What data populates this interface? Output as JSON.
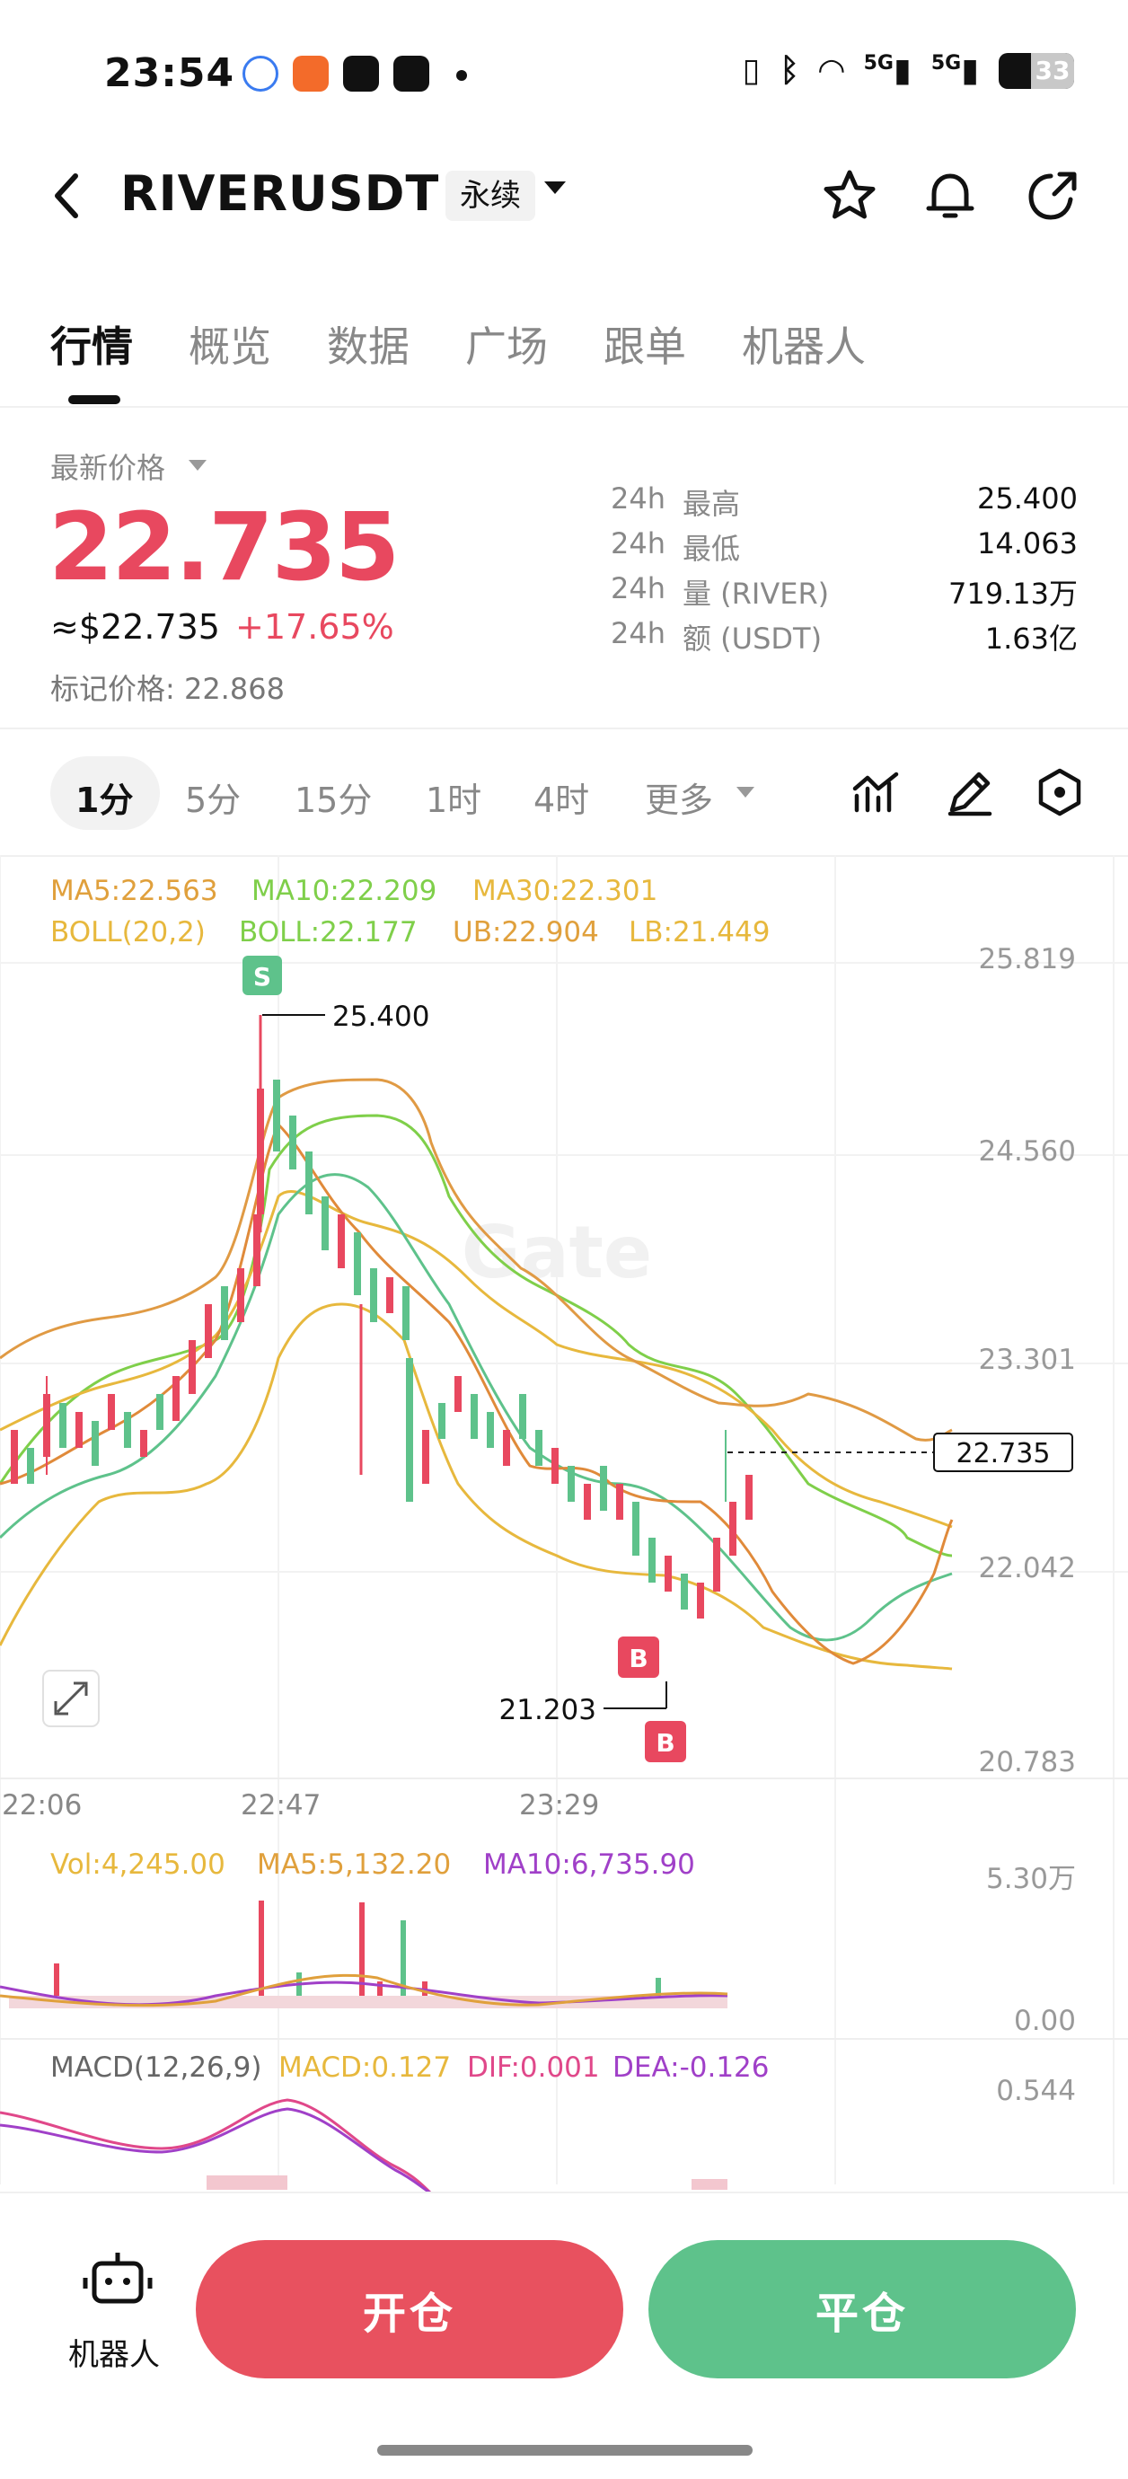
{
  "status_bar": {
    "time": "23:54",
    "network_1": "5G",
    "network_2": "5G",
    "battery": "33"
  },
  "header": {
    "symbol": "RIVERUSDT",
    "contract_type": "永续"
  },
  "tabs": [
    "行情",
    "概览",
    "数据",
    "广场",
    "跟单",
    "机器人"
  ],
  "price": {
    "label": "最新价格",
    "last": "22.735",
    "usd": "≈$22.735",
    "change": "+17.65%",
    "mark": "标记价格: 22.868"
  },
  "stats": [
    {
      "period": "24h",
      "label": "最高",
      "value": "25.400"
    },
    {
      "period": "24h",
      "label": "最低",
      "value": "14.063"
    },
    {
      "period": "24h",
      "label": "量 (RIVER)",
      "value": "719.13万"
    },
    {
      "period": "24h",
      "label": "额 (USDT)",
      "value": "1.63亿"
    }
  ],
  "intervals": [
    "1分",
    "5分",
    "15分",
    "1时",
    "4时",
    "更多"
  ],
  "indicators": {
    "ma5": "MA5:22.563",
    "ma10": "MA10:22.209",
    "ma30": "MA30:22.301",
    "boll": "BOLL(20,2)",
    "boll_mid": "BOLL:22.177",
    "ub": "UB:22.904",
    "lb": "LB:21.449",
    "vol": "Vol:4,245.00",
    "vol_ma5": "MA5:5,132.20",
    "vol_ma10": "MA10:6,735.90",
    "macd_params": "MACD(12,26,9)",
    "macd": "MACD:0.127",
    "dif": "DIF:0.001",
    "dea": "DEA:-0.126"
  },
  "colors": {
    "up": "#e8485f",
    "down": "#5ec28b",
    "ma5": "#e0a03c",
    "ma10": "#7fcf4a",
    "ma30": "#e7b83d",
    "macd_dif": "#e0488a",
    "macd_dea": "#a040c8"
  },
  "chart_data": {
    "type": "candlestick",
    "y_ticks": [
      "25.819",
      "24.560",
      "23.301",
      "22.042",
      "20.783"
    ],
    "x_ticks": [
      "22:06",
      "22:47",
      "23:29"
    ],
    "current_price_tag": "22.735",
    "high_marker": "25.400",
    "low_marker": "21.203",
    "sell_marker": "S",
    "buy_marker": "B",
    "volume_ticks": [
      "5.30万",
      "0.00"
    ],
    "macd_tick": "0.544"
  },
  "bottom_bar": {
    "robot": "机器人",
    "open": "开仓",
    "close": "平仓"
  }
}
